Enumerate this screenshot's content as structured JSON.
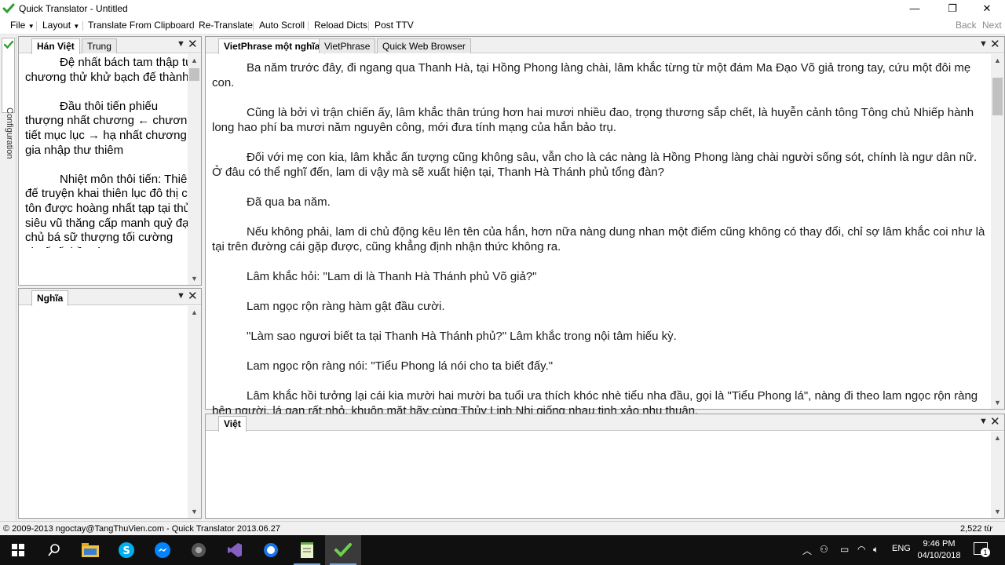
{
  "window": {
    "title": "Quick Translator - Untitled",
    "minimize_glyph": "—",
    "maximize_glyph": "❐",
    "close_glyph": "✕"
  },
  "menu": {
    "items": [
      "File",
      "Layout",
      "Translate From Clipboard",
      "Re-Translate",
      "Auto Scroll",
      "Reload Dicts",
      "Post TTV"
    ],
    "back": "Back",
    "next": "Next"
  },
  "sidebar": {
    "config_label": "Configuration"
  },
  "left_top_panel": {
    "tabs": [
      "Hán Việt",
      "Trung"
    ],
    "paragraphs": [
      "Đệ nhất bách tam thập tứ chương thử khử bạch đế thành",
      "Đầu thôi tiến phiếu thượng nhất chương ← chương tiết mục lục → hạ nhất chương gia nhập thư thiêm",
      "Nhiệt môn thôi tiến: Thiên đế truyện khai thiên lục đô thị chí tôn được hoàng nhất tạp tại thủ siêu vũ thăng cấp manh quỷ đại chủ bá sữ thượng tối cường chuế tế thần tàng"
    ]
  },
  "left_bottom_panel": {
    "tabs": [
      "Nghĩa"
    ]
  },
  "main_panel": {
    "tabs": [
      "VietPhrase một nghĩa",
      "VietPhrase",
      "Quick Web Browser"
    ],
    "paragraphs": [
      "Ba năm trước đây, đi ngang qua Thanh Hà, tại Hồng Phong làng chài, lâm khắc từng từ một đám Ma Đạo Võ giả trong tay, cứu một đôi mẹ con.",
      "Cũng là bởi vì trận chiến ấy, lâm khắc thân trúng hơn hai mươi nhiều đao, trọng thương sắp chết, là huyễn cảnh tông Tông chủ Nhiếp hành long hao phí ba mươi năm nguyên công, mới đưa tính mạng của hắn bảo trụ.",
      "Đối với mẹ con kia, lâm khắc ấn tượng cũng không sâu, vẫn cho là các nàng là Hồng Phong làng chài người sống sót, chính là ngư dân nữ. Ở đâu có thể nghĩ đến, lam di vậy mà sẽ xuất hiện tại, Thanh Hà Thánh phủ tổng đàn?",
      "Đã qua ba năm.",
      "Nếu không phải, lam di chủ động kêu lên tên của hắn, hơn nữa nàng dung nhan một điểm cũng không có thay đổi, chỉ sợ lâm khắc coi như là tại trên đường cái gặp được, cũng khẳng định nhận thức không ra.",
      "Lâm khắc hỏi: \"Lam di là Thanh Hà Thánh phủ Võ giả?\"",
      "Lam ngọc rộn ràng hàm gật đầu cười.",
      "\"Làm sao ngươi biết ta tại Thanh Hà Thánh phủ?\" Lâm khắc trong nội tâm hiếu kỳ.",
      "Lam ngọc rộn ràng nói: \"Tiểu Phong lá nói cho ta biết đấy.\"",
      "Lâm khắc hồi tưởng lại cái kia mười hai mười ba tuổi ưa thích khóc nhè tiểu nha đầu, gọi là \"Tiểu Phong lá\", nàng đi theo lam ngọc rộn ràng bên người, lá gan rất nhỏ, khuôn mặt hãy cùng Thủy Linh Nhi giống nhau tinh xảo nhu thuận."
    ]
  },
  "viet_panel": {
    "tabs": [
      "Việt"
    ]
  },
  "status": {
    "left": "© 2009-2013 ngoctay@TangThuVien.com - Quick Translator 2013.06.27",
    "right": "2,522 từ"
  },
  "taskbar": {
    "language": "ENG",
    "time": "9:46 PM",
    "date": "04/10/2018",
    "notification_count": "1"
  },
  "colors": {
    "accent_green": "#2e9e2e",
    "taskbar_bg": "#101010"
  }
}
